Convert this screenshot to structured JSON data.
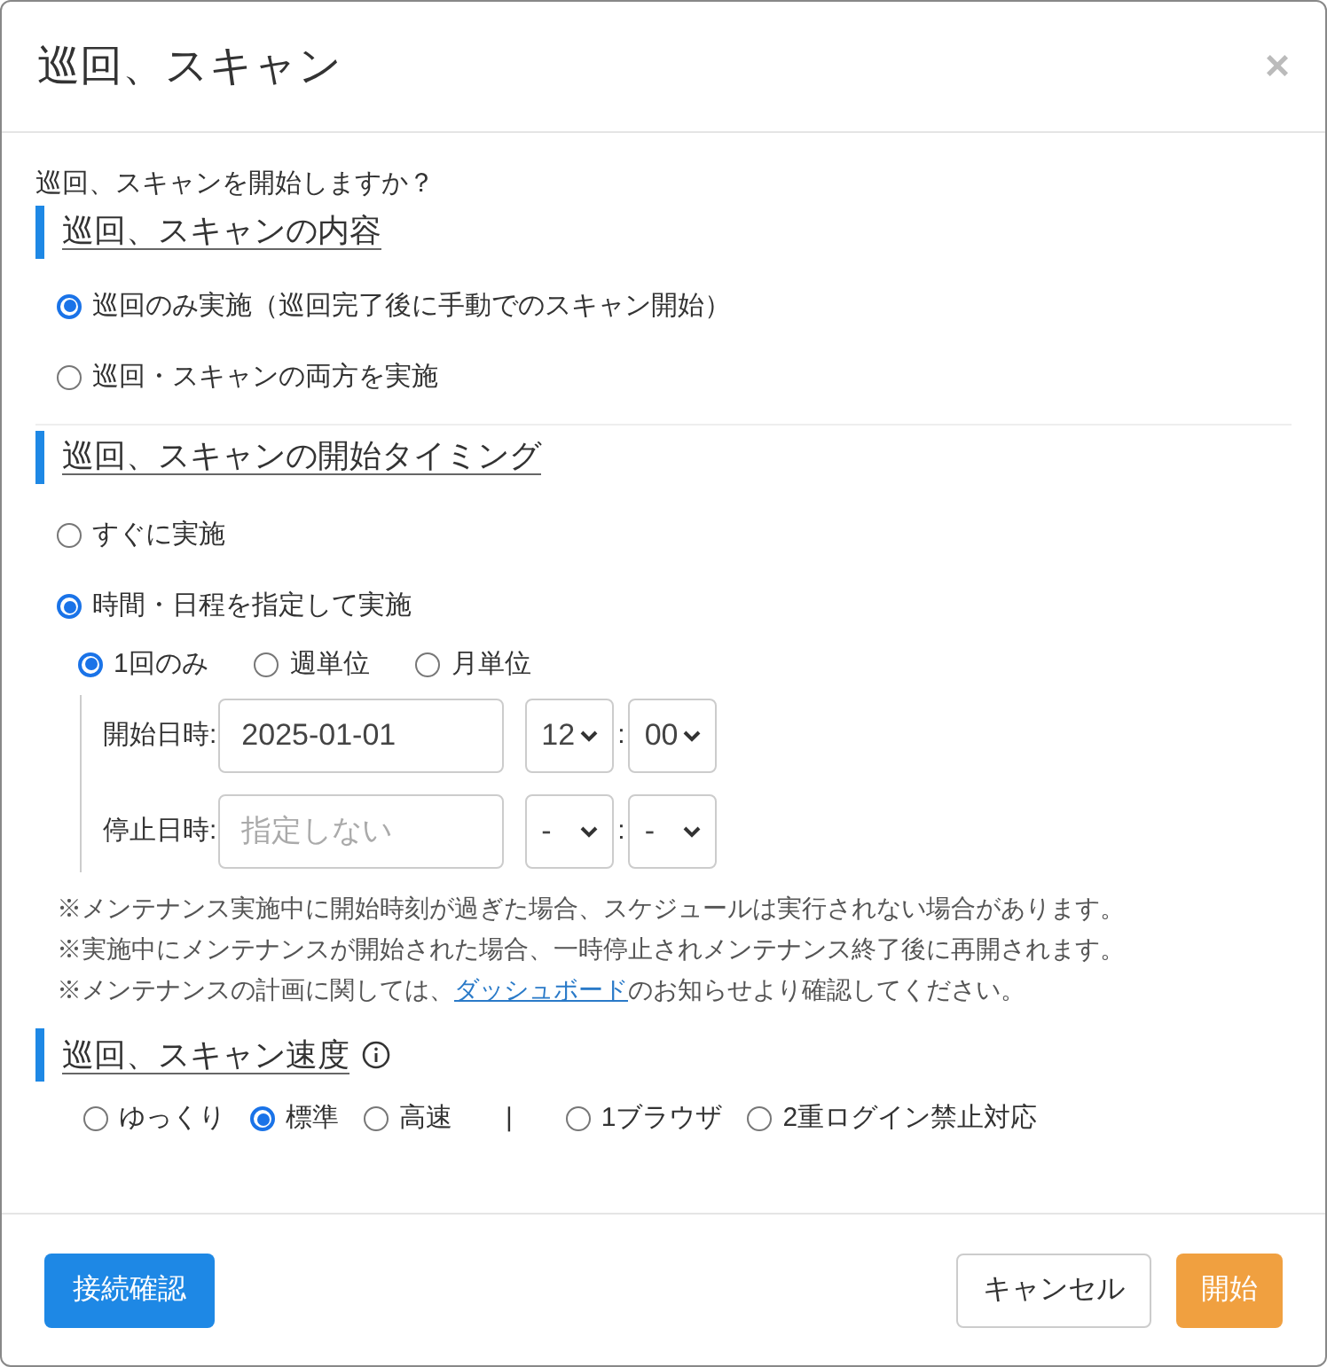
{
  "dialog": {
    "title": "巡回、スキャン",
    "close": "×"
  },
  "question": "巡回、スキャンを開始しますか？",
  "content_section": {
    "heading": "巡回、スキャンの内容",
    "options": [
      {
        "label": "巡回のみ実施（巡回完了後に手動でのスキャン開始）",
        "selected": true
      },
      {
        "label": "巡回・スキャンの両方を実施",
        "selected": false
      }
    ]
  },
  "timing_section": {
    "heading": "巡回、スキャンの開始タイミング",
    "options": [
      {
        "label": "すぐに実施",
        "selected": false
      },
      {
        "label": "時間・日程を指定して実施",
        "selected": true
      }
    ],
    "frequency": [
      {
        "label": "1回のみ",
        "selected": true
      },
      {
        "label": "週単位",
        "selected": false
      },
      {
        "label": "月単位",
        "selected": false
      }
    ],
    "start": {
      "label": "開始日時:",
      "date": "2025-01-01",
      "hour": "12",
      "colon": ":",
      "minute": "00"
    },
    "stop": {
      "label": "停止日時:",
      "placeholder": "指定しない",
      "hour": "-",
      "colon": ":",
      "minute": "-"
    }
  },
  "notes": [
    {
      "before": "※メンテナンス実施中に開始時刻が過ぎた場合、スケジュールは実行されない場合があります。"
    },
    {
      "before": "※実施中にメンテナンスが開始された場合、一時停止されメンテナンス終了後に再開されます。"
    },
    {
      "before": "※メンテナンスの計画に関しては、",
      "link": "ダッシュボード",
      "after": "のお知らせより確認してください。"
    }
  ],
  "speed_section": {
    "heading": "巡回、スキャン速度",
    "options": [
      {
        "kind": "radio",
        "label": "ゆっくり",
        "selected": false
      },
      {
        "kind": "radio",
        "label": "標準",
        "selected": true
      },
      {
        "kind": "radio",
        "label": "高速",
        "selected": false
      },
      {
        "kind": "separator",
        "label": "|"
      },
      {
        "kind": "radio",
        "label": "1ブラウザ",
        "selected": false
      },
      {
        "kind": "radio",
        "label": "2重ログイン禁止対応",
        "selected": false
      }
    ]
  },
  "buttons": {
    "check": "接続確認",
    "cancel": "キャンセル",
    "start": "開始"
  }
}
